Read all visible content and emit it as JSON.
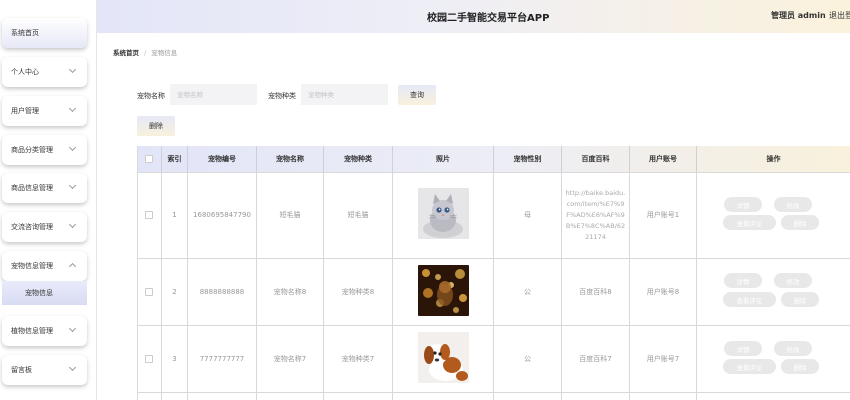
{
  "app": {
    "title": "校园二手智能交易平台APP",
    "admin_label": "管理员 admin",
    "logout_label": "退出登"
  },
  "sidebar": {
    "items": [
      {
        "label": "系统首页"
      },
      {
        "label": "个人中心"
      },
      {
        "label": "用户管理"
      },
      {
        "label": "商品分类管理"
      },
      {
        "label": "商品信息管理"
      },
      {
        "label": "交流咨询管理"
      },
      {
        "label": "宠物信息管理"
      },
      {
        "label": "植物信息管理"
      },
      {
        "label": "留言板"
      }
    ],
    "submenu_label": "宠物信息"
  },
  "breadcrumb": {
    "home": "系统首页",
    "current": "宠物信息"
  },
  "search": {
    "name_label": "宠物名称",
    "name_placeholder": "宠物名称",
    "type_label": "宠物种类",
    "type_placeholder": "宠物种类",
    "query_button": "查询"
  },
  "toolbar": {
    "delete_button": "删除"
  },
  "table": {
    "headers": [
      "索引",
      "宠物编号",
      "宠物名称",
      "宠物种类",
      "照片",
      "宠物性别",
      "百度百科",
      "用户账号",
      "操作"
    ],
    "rows": [
      {
        "index": "1",
        "code": "1680695847790",
        "name": "短毛猫",
        "type": "短毛猫",
        "photo": "kitten",
        "gender": "母",
        "baike": "http://baike.baidu.com/item/%E7%9F%AD%E6%AF%9B%E7%8C%AB/6221174",
        "user": "用户账号1"
      },
      {
        "index": "2",
        "code": "8888888888",
        "name": "宠物名称8",
        "type": "宠物种类8",
        "photo": "bokeh",
        "gender": "公",
        "baike": "百度百科8",
        "user": "用户账号8"
      },
      {
        "index": "3",
        "code": "7777777777",
        "name": "宠物名称7",
        "type": "宠物种类7",
        "photo": "puppy",
        "gender": "公",
        "baike": "百度百科7",
        "user": "用户账号7"
      }
    ],
    "actions": {
      "detail": "详情",
      "edit": "修改",
      "comments": "查看评论",
      "delete": "删除"
    }
  },
  "colors": {
    "accent_blue": "#e3e6f8",
    "accent_cream": "#fbf2dc"
  }
}
